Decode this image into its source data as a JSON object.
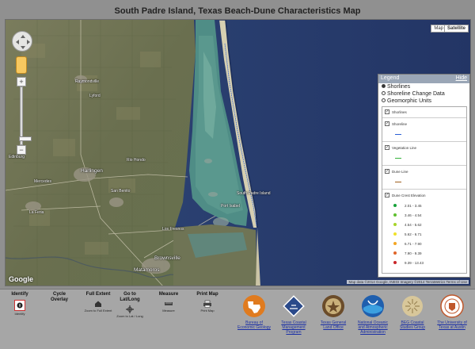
{
  "page": {
    "title": "South Padre Island, Texas Beach-Dune Characteristics Map"
  },
  "map": {
    "type_buttons": {
      "map": "Map",
      "satellite": "Satellite"
    },
    "zoom": {
      "in": "+",
      "out": "−"
    },
    "cities": [
      {
        "name": "Raymondville"
      },
      {
        "name": "Harlingen"
      },
      {
        "name": "Mercedes"
      },
      {
        "name": "Edinburg"
      },
      {
        "name": "San Benito"
      },
      {
        "name": "Rio Hondo"
      },
      {
        "name": "Los Fresnos"
      },
      {
        "name": "Brownsville"
      },
      {
        "name": "Matamoros"
      },
      {
        "name": "South Padre Island"
      },
      {
        "name": "Port Isabel"
      },
      {
        "name": "Lyford"
      },
      {
        "name": "La Feria"
      }
    ],
    "google_logo": "Google",
    "attribution": "Map data ©2014 Google, INEGI Imagery ©2014 TerraMetrics   Terms of Use"
  },
  "legend": {
    "title": "Legend",
    "hide": "Hide",
    "modes": [
      {
        "label": "Shorlines",
        "selected": true
      },
      {
        "label": "Shoreline Change Data",
        "selected": false
      },
      {
        "label": "Geomorphic Units",
        "selected": false
      }
    ],
    "layers": [
      {
        "label": "Shorlines",
        "color": ""
      },
      {
        "label": "Shoreline",
        "color": "#2a5fd6"
      },
      {
        "label": "Vegetation Line",
        "color": "#35b23b"
      },
      {
        "label": "Dune Line",
        "color": "#a0601e"
      },
      {
        "label": "Dune Crest Elevation",
        "color": ""
      }
    ],
    "elevation_classes": [
      {
        "range": "2.01 - 3.45",
        "color": "#17a23a"
      },
      {
        "range": "3.46 - 4.54",
        "color": "#5fbf2f"
      },
      {
        "range": "4.54 - 5.62",
        "color": "#a7d42a"
      },
      {
        "range": "5.62 - 6.71",
        "color": "#f0e12a"
      },
      {
        "range": "6.71 - 7.90",
        "color": "#f4a623"
      },
      {
        "range": "7.90 - 9.39",
        "color": "#e0662a"
      },
      {
        "range": "9.39 - 13.43",
        "color": "#c9262a"
      }
    ]
  },
  "toolbar": {
    "tools": [
      {
        "label": "Identify",
        "sub": "Identify"
      },
      {
        "label": "Cycle Overlay",
        "sub": ""
      },
      {
        "label": "Full Extent",
        "sub": "Zoom to Full Extent"
      },
      {
        "label": "Go to Lat/Long",
        "sub": "Zoom to Lat / Long"
      },
      {
        "label": "Measure",
        "sub": "Measure"
      },
      {
        "label": "Print Map",
        "sub": "Print Map"
      }
    ],
    "partners": [
      {
        "name": "Bureau of Economic Geology"
      },
      {
        "name": "Texas Coastal Management Program"
      },
      {
        "name": "Texas General Land Office"
      },
      {
        "name": "National Oceanic and Atmospheric Administration"
      },
      {
        "name": "BEG Coastal Studies Group"
      },
      {
        "name": "The University of Texas at Austin"
      }
    ]
  },
  "colors": {
    "ocean": "#2b3e6c",
    "land": "#6f7557",
    "lagoon": "#5a8f8c",
    "legend_header": "#9aa6b6",
    "link": "#1a2fa6"
  }
}
